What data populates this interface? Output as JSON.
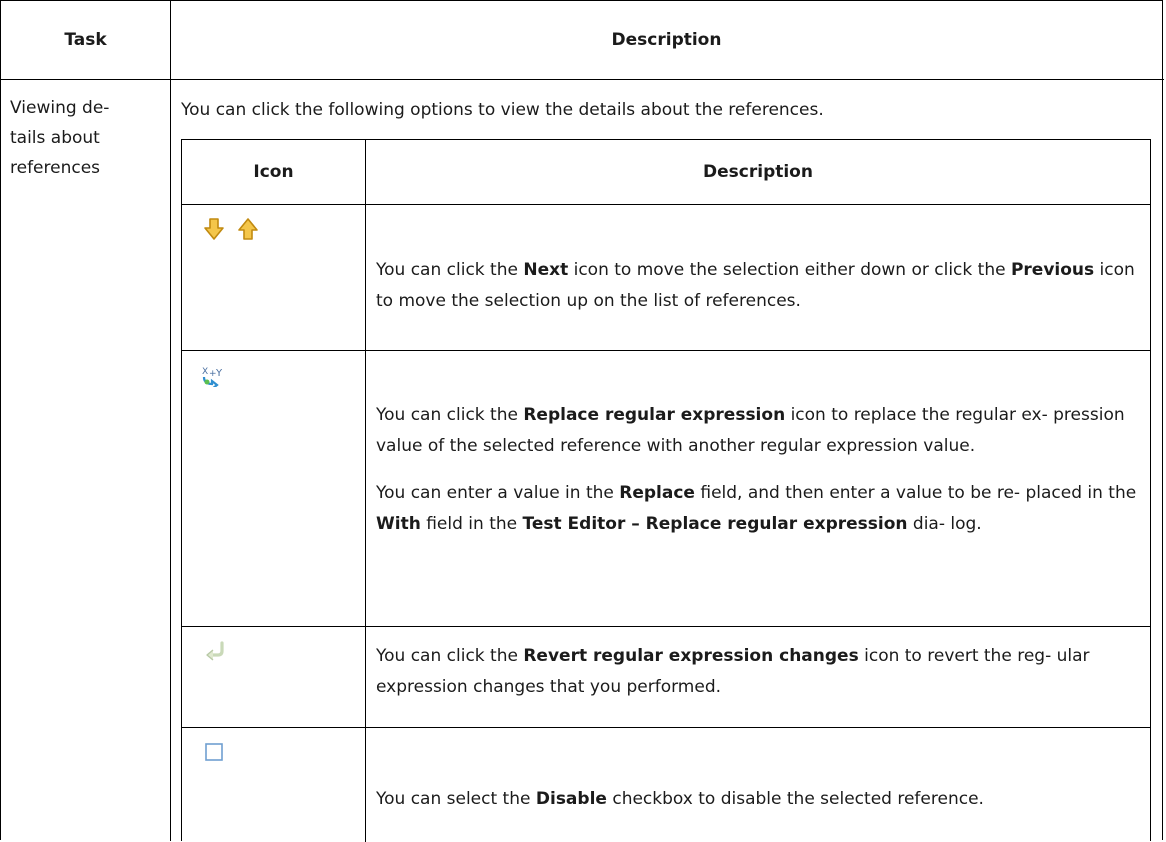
{
  "table": {
    "header_task": "Task",
    "header_description": "Description"
  },
  "row": {
    "task_line1": "Viewing de-",
    "task_line2": "tails about",
    "task_line3": "references",
    "intro": "You can click the following options to view the details about the references."
  },
  "inner_table": {
    "header_icon": "Icon",
    "header_description": "Description",
    "rows": [
      {
        "icons": [
          "next-arrow-down-icon",
          "previous-arrow-up-icon"
        ],
        "p1_pre": "You can click the ",
        "p1_b1": "Next",
        "p1_mid": " icon to move the selection either down or click the ",
        "p1_b2": "Previous",
        "p1_post": " icon to move the selection up on the list of references."
      },
      {
        "icons": [
          "replace-regex-icon"
        ],
        "p1_pre": "You can click the ",
        "p1_b1": "Replace regular expression",
        "p1_post": " icon to replace the regular ex- pression value of the selected reference with another regular expression value.",
        "p2_pre": "You can enter a value in the ",
        "p2_b1": "Replace",
        "p2_mid1": " field, and then enter a value to be re- placed in the ",
        "p2_b2": "With",
        "p2_mid2": " field in the ",
        "p2_b3": "Test Editor – Replace regular expression",
        "p2_post": " dia- log."
      },
      {
        "icons": [
          "revert-regex-icon"
        ],
        "p1_pre": "You can click the ",
        "p1_b1": "Revert regular expression changes",
        "p1_post": " icon to revert the reg- ular expression changes that you performed."
      },
      {
        "icons": [
          "disable-checkbox-icon"
        ],
        "p1_pre": "You can select the ",
        "p1_b1": "Disable",
        "p1_post": " checkbox to disable the selected reference."
      }
    ]
  },
  "colors": {
    "arrow_fill": "#f4c64a",
    "arrow_stroke": "#c18a10",
    "icon_blue": "#4a84c4",
    "border": "#000000"
  }
}
